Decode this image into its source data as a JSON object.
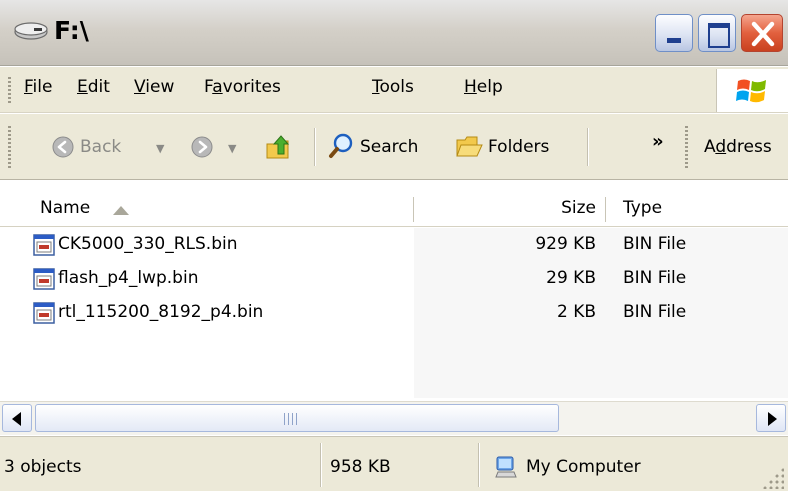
{
  "window": {
    "title": "F:\\",
    "icon": "drive-icon"
  },
  "menu": {
    "items": [
      {
        "key": "F",
        "rest": "ile"
      },
      {
        "key": "E",
        "rest": "dit"
      },
      {
        "key": "V",
        "rest": "iew"
      },
      {
        "pre": "F",
        "key": "a",
        "rest": "vorites"
      },
      {
        "key": "T",
        "rest": "ools"
      },
      {
        "key": "H",
        "rest": "elp"
      }
    ]
  },
  "toolbar": {
    "back_label": "Back",
    "search_label": "Search",
    "folders_label": "Folders",
    "more_label": "»",
    "address_pre": "A",
    "address_key": "d",
    "address_rest": "dress"
  },
  "columns": {
    "name": "Name",
    "size": "Size",
    "type": "Type"
  },
  "files": [
    {
      "name": "CK5000_330_RLS.bin",
      "size": "929 KB",
      "type": "BIN File"
    },
    {
      "name": "flash_p4_lwp.bin",
      "size": "29 KB",
      "type": "BIN File"
    },
    {
      "name": "rtl_115200_8192_p4.bin",
      "size": "2 KB",
      "type": "BIN File"
    }
  ],
  "status": {
    "objects": "3 objects",
    "total_size": "958 KB",
    "zone": "My Computer"
  },
  "colors": {
    "titlebar": "#d4d0c8",
    "menubar": "#ece9d8",
    "close_button": "#e2603e",
    "window_button": "#dde4f3"
  }
}
